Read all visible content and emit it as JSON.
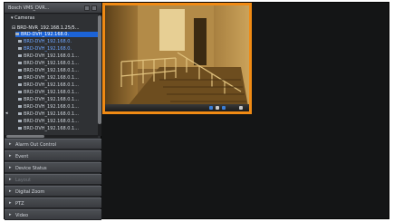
{
  "panel": {
    "title": "Bosch VMS_DVR...",
    "tree_root": "Cameras",
    "tree_node": "BRD-NVR_192.168.1.25/5...",
    "items": [
      {
        "label": "BRD-DVH_192.168.0.",
        "state": "selected"
      },
      {
        "label": "BRD-DVH_192.168.0.",
        "state": "blue"
      },
      {
        "label": "BRD-DVH_192.168.0.",
        "state": "blue"
      },
      {
        "label": "BRD-DVH_192.168.0.1...",
        "state": "normal"
      },
      {
        "label": "BRD-DVH_192.168.0.1...",
        "state": "normal"
      },
      {
        "label": "BRD-DVH_192.168.0.1...",
        "state": "normal"
      },
      {
        "label": "BRD-DVH_192.168.0.1...",
        "state": "normal"
      },
      {
        "label": "BRD-DVH_192.168.0.1...",
        "state": "normal"
      },
      {
        "label": "BRD-DVH_192.168.0.1...",
        "state": "normal"
      },
      {
        "label": "BRD-DVH_192.168.0.1...",
        "state": "normal"
      },
      {
        "label": "BRD-DVH_192.168.0.1...",
        "state": "normal"
      },
      {
        "label": "BRD-DVH_192.168.0.1...",
        "state": "normal"
      },
      {
        "label": "BRD-DVH_192.168.0.1...",
        "state": "normal"
      },
      {
        "label": "BRD-DVH_192.168.0.1...",
        "state": "normal"
      }
    ],
    "sections": [
      {
        "label": "Alarm Out Control",
        "dim": false
      },
      {
        "label": "Event",
        "dim": false
      },
      {
        "label": "Device Status",
        "dim": false
      },
      {
        "label": "Layout",
        "dim": true
      },
      {
        "label": "Digital Zoom",
        "dim": false
      },
      {
        "label": "PTZ",
        "dim": false
      },
      {
        "label": "Video",
        "dim": false
      }
    ]
  },
  "colors": {
    "accent": "#f08a14",
    "selection": "#1c63d6",
    "panel_bg": "#2b2d30",
    "canvas_bg": "#141516"
  },
  "icons": {
    "section_arrow": "▸",
    "collapse": "◂"
  }
}
